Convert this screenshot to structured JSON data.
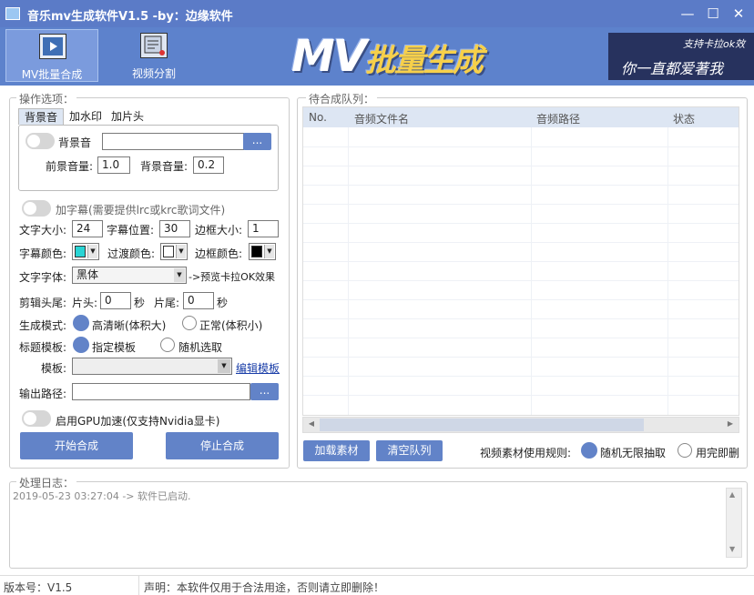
{
  "window": {
    "title": "音乐mv生成软件V1.5 -by：边缘软件"
  },
  "toolbar": {
    "batch_label": "MV批量合成",
    "split_label": "视频分割",
    "logo_mv": "MV",
    "logo_cn": "批量生成",
    "banner_line1": "支持卡拉ok效",
    "banner_line2": "你一直都爱著我"
  },
  "options": {
    "legend": "操作选项：",
    "tabs": [
      "背景音",
      "加水印",
      "加片头"
    ],
    "bgm_label": "背景音",
    "bgm_path": "",
    "browse": "...",
    "fg_volume_label": "前景音量:",
    "fg_volume": "1.0",
    "bg_volume_label": "背景音量:",
    "bg_volume": "0.2",
    "subtitle_label": "加字幕(需要提供lrc或krc歌词文件)",
    "font_size_label": "文字大小:",
    "font_size": "24",
    "sub_pos_label": "字幕位置:",
    "sub_pos": "30",
    "border_size_label": "边框大小:",
    "border_size": "1",
    "sub_color_label": "字幕颜色:",
    "sub_color": "#29d4d4",
    "trans_color_label": "过渡颜色:",
    "trans_color": "#ffffff",
    "border_color_label": "边框颜色:",
    "border_color": "#000000",
    "font_label": "文字字体:",
    "font_value": "黑体",
    "preview_label": "->预览卡拉OK效果",
    "trim_label": "剪辑头尾:",
    "head_label": "片头:",
    "head_value": "0",
    "sec1": "秒",
    "tail_label": "片尾:",
    "tail_value": "0",
    "sec2": "秒",
    "mode_label": "生成模式:",
    "mode_hd": "高清晰(体积大)",
    "mode_normal": "正常(体积小)",
    "template_label": "标题模板:",
    "tpl_fixed": "指定模板",
    "tpl_random": "随机选取",
    "tpl_select_label": "模板:",
    "tpl_select_value": "",
    "edit_template": "编辑模板",
    "output_label": "输出路径:",
    "output_path": "",
    "gpu_label": "启用GPU加速(仅支持Nvidia显卡)",
    "start_button": "开始合成",
    "stop_button": "停止合成"
  },
  "queue": {
    "legend": "待合成队列：",
    "columns": [
      "No.",
      "音频文件名",
      "音频路径",
      "状态"
    ],
    "add_button": "加载素材",
    "clear_button": "清空队列",
    "rule_label": "视频素材使用规则:",
    "rule_random": "随机无限抽取",
    "rule_once": "用完即删"
  },
  "log": {
    "legend": "处理日志：",
    "lines": [
      "2019-05-23 03:27:04 -> 软件已启动."
    ]
  },
  "status": {
    "version": "版本号：V1.5",
    "notice": "声明：本软件仅用于合法用途，否则请立即删除！"
  }
}
